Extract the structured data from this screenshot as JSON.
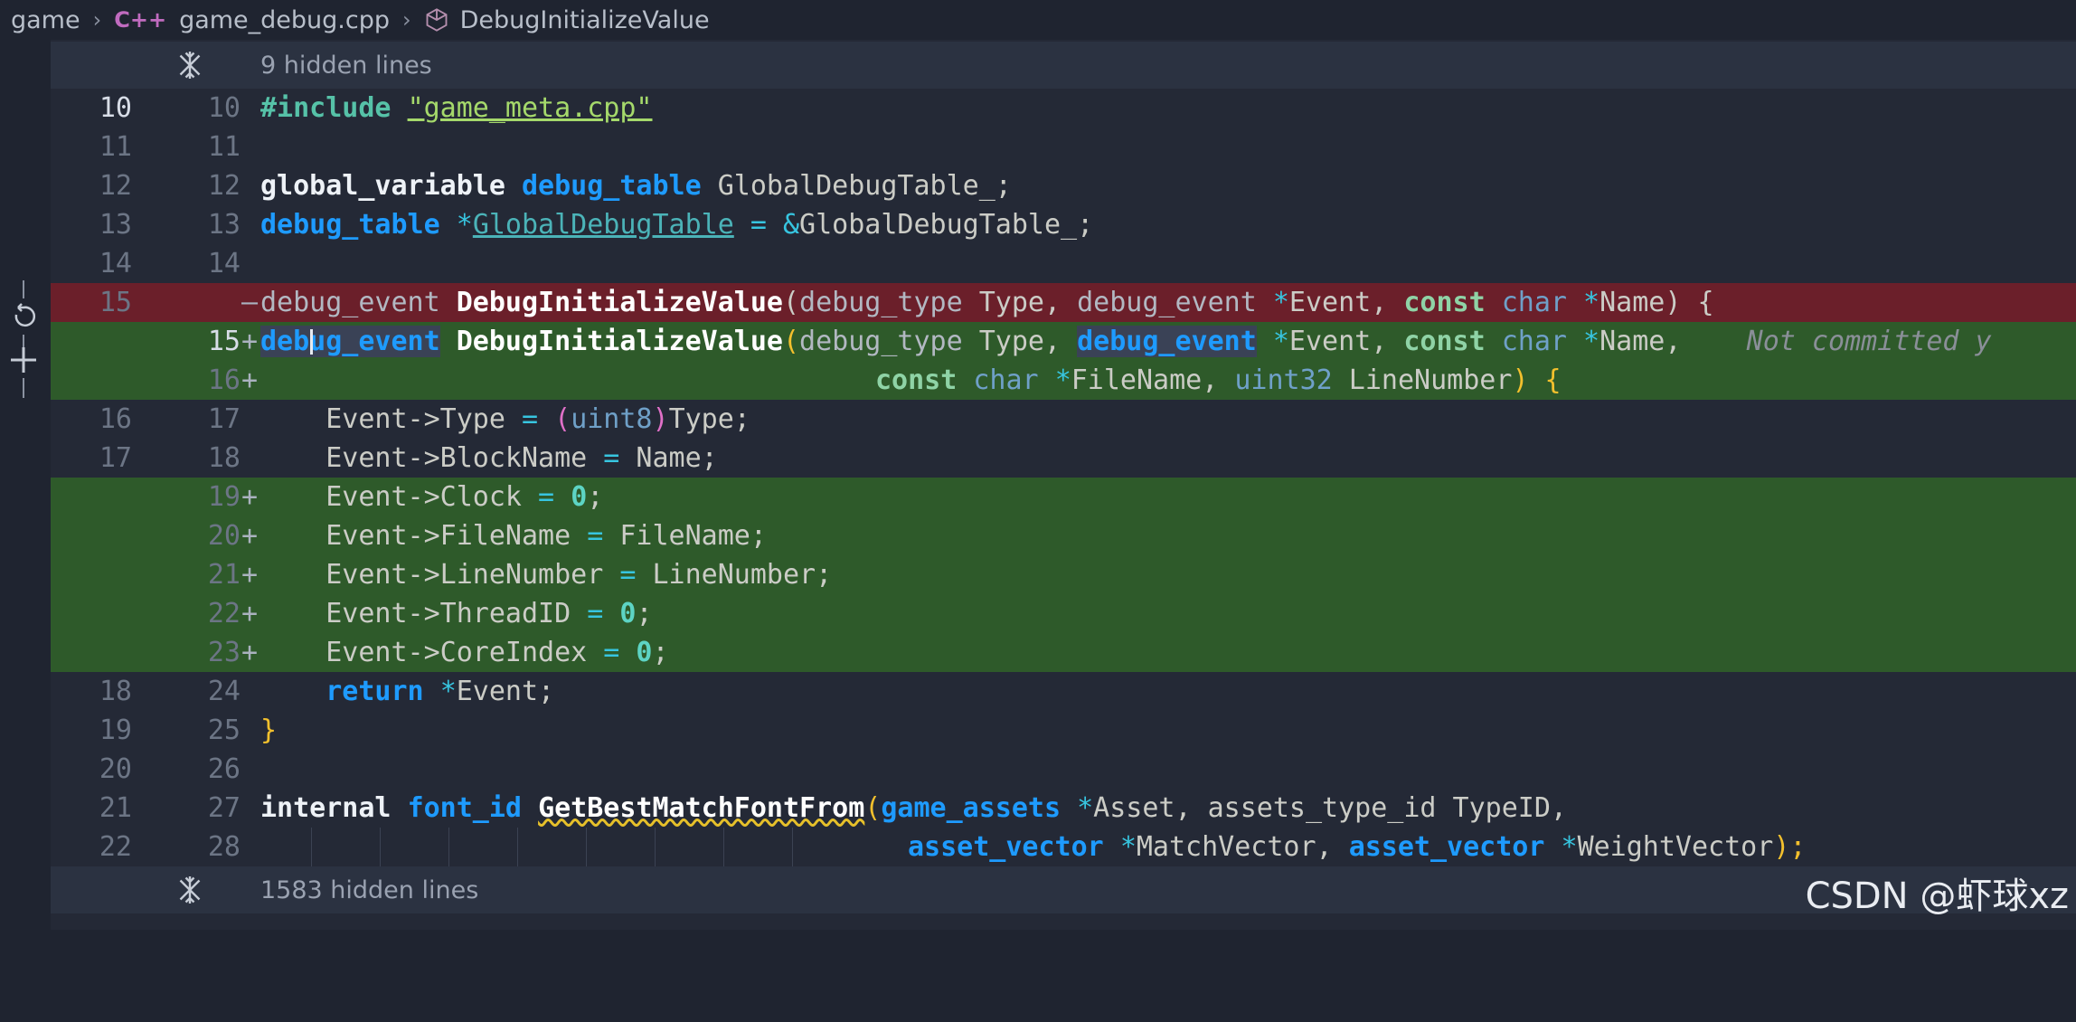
{
  "breadcrumb": {
    "root": "game",
    "file": "game_debug.cpp",
    "file_icon": "C++",
    "symbol": "DebugInitializeValue"
  },
  "hidden_top": "9 hidden lines",
  "hidden_bottom": "1583 hidden lines",
  "lines": {
    "l10": {
      "a": "10",
      "b": "10"
    },
    "l11": {
      "a": "11",
      "b": "11"
    },
    "l12": {
      "a": "12",
      "b": "12"
    },
    "l13": {
      "a": "13",
      "b": "13"
    },
    "l14": {
      "a": "14",
      "b": "14"
    },
    "l15d": {
      "a": "15",
      "mark": "—"
    },
    "l15a": {
      "b": "15",
      "mark": "+"
    },
    "l16a": {
      "b": "16",
      "mark": "+"
    },
    "l16": {
      "a": "16",
      "b": "17"
    },
    "l17": {
      "a": "17",
      "b": "18"
    },
    "l19a": {
      "b": "19",
      "mark": "+"
    },
    "l20a": {
      "b": "20",
      "mark": "+"
    },
    "l21a": {
      "b": "21",
      "mark": "+"
    },
    "l22a": {
      "b": "22",
      "mark": "+"
    },
    "l23a": {
      "b": "23",
      "mark": "+"
    },
    "l18": {
      "a": "18",
      "b": "24"
    },
    "l19": {
      "a": "19",
      "b": "25"
    },
    "l20": {
      "a": "20",
      "b": "26"
    },
    "l21": {
      "a": "21",
      "b": "27"
    },
    "l22": {
      "a": "22",
      "b": "28"
    }
  },
  "code": {
    "include_kw": "#include",
    "include_file": "\"game_meta.cpp\"",
    "global_variable": "global_variable",
    "debug_table": "debug_table",
    "global_table_": "GlobalDebugTable_;",
    "star": "*",
    "global_table": "GlobalDebugTable",
    "eq_amp": " = &",
    "global_table_2": "GlobalDebugTable_;",
    "debug_event": "debug_event",
    "fn_name": "DebugInitializeValue",
    "lparen": "(",
    "debug_type": "debug_type",
    "type_arg": " Type, ",
    "event_arg": "Event, ",
    "const": "const",
    "char": "char",
    "name_arg": "Name) {",
    "name_arg_new": "Name,",
    "ghost": "Not committed y",
    "filename_arg": "FileName, ",
    "uint32": "uint32",
    "linenumber_arg": " LineNumber",
    "rparen_brace": ") {",
    "evt_type": "Event->Type",
    "uint8": "uint8",
    "type_end": "Type;",
    "evt_block": "Event->BlockName",
    "name_end": " Name;",
    "evt_clock": "Event->Clock",
    "zero": "0",
    "evt_file": "Event->FileName",
    "filename_end": " FileName;",
    "evt_line": "Event->LineNumber",
    "line_end": " LineNumber;",
    "evt_thread": "Event->ThreadID",
    "evt_core": "Event->CoreIndex",
    "semi": ";",
    "eq": " = ",
    "return": "return",
    "event_end": "Event;",
    "close_brace": "}",
    "internal": "internal",
    "font_id": "font_id",
    "get_best": "GetBestMatchFontFrom",
    "game_assets": "game_assets",
    "asset_arg": "Asset, assets_type_id TypeID,",
    "asset_vector": "asset_vector",
    "match_vec": "MatchVector, ",
    "weight_vec": "WeightVector",
    "end_call": ");"
  },
  "watermark": "CSDN @虾球xz"
}
